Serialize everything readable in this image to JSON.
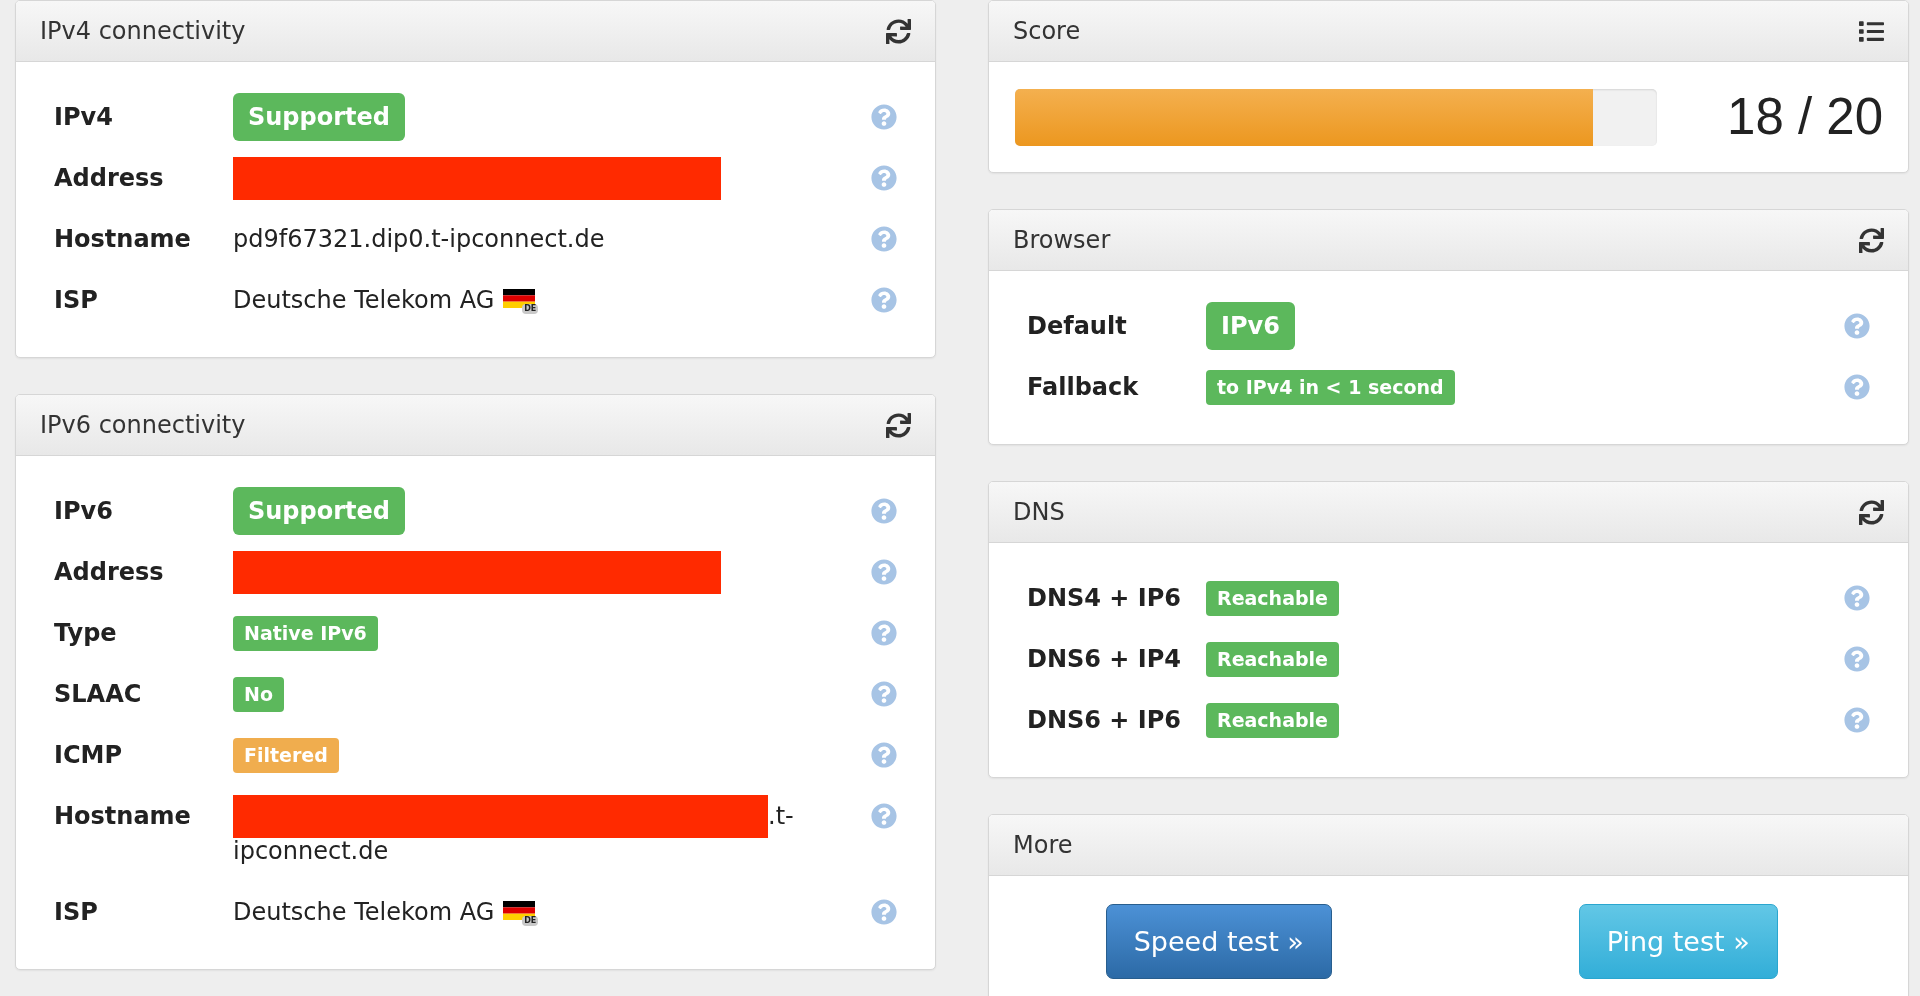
{
  "left_column": {
    "panels": [
      {
        "kind": "checks",
        "title": "IPv4 connectivity",
        "rows": [
          {
            "label": "IPv4",
            "kind": "result",
            "value": "Supported",
            "color": "#5cb85c"
          },
          {
            "label": "Address",
            "kind": "redacted"
          },
          {
            "label": "Hostname",
            "kind": "text",
            "value": "pd9f67321.dip0.t-ipconnect.de"
          },
          {
            "label": "ISP",
            "kind": "isp",
            "value": "Deutsche Telekom AG",
            "flag_code": "DE"
          }
        ]
      },
      {
        "kind": "checks",
        "title": "IPv6 connectivity",
        "rows": [
          {
            "label": "IPv6",
            "kind": "result",
            "value": "Supported",
            "color": "#5cb85c"
          },
          {
            "label": "Address",
            "kind": "redacted"
          },
          {
            "label": "Type",
            "kind": "badge",
            "value": "Native IPv6",
            "color": "#5cb85c"
          },
          {
            "label": "SLAAC",
            "kind": "badge",
            "value": "No",
            "color": "#5cb85c"
          },
          {
            "label": "ICMP",
            "kind": "badge",
            "value": "Filtered",
            "color": "#f0ad4e"
          },
          {
            "label": "Hostname",
            "kind": "redacted",
            "suffix_lines": [
              ".t-",
              "ipconnect.de"
            ]
          },
          {
            "label": "ISP",
            "kind": "isp",
            "value": "Deutsche Telekom AG",
            "flag_code": "DE"
          }
        ]
      }
    ]
  },
  "right_column": {
    "panels": [
      {
        "kind": "score",
        "title": "Score",
        "level": 0.9,
        "reading": "18 / 20"
      },
      {
        "kind": "checks",
        "title": "Browser",
        "rows": [
          {
            "label": "Default",
            "kind": "result",
            "value": "IPv6",
            "color": "#5cb85c"
          },
          {
            "label": "Fallback",
            "kind": "badge",
            "value": "to IPv4 in < 1 second",
            "color": "#5cb85c"
          }
        ]
      },
      {
        "kind": "checks",
        "title": "DNS",
        "rows": [
          {
            "label": "DNS4 + IP6",
            "kind": "badge",
            "value": "Reachable",
            "color": "#5cb85c"
          },
          {
            "label": "DNS6 + IP4",
            "kind": "badge",
            "value": "Reachable",
            "color": "#5cb85c"
          },
          {
            "label": "DNS6 + IP6",
            "kind": "badge",
            "value": "Reachable",
            "color": "#5cb85c"
          }
        ]
      },
      {
        "kind": "actions",
        "title": "More",
        "buttons": [
          {
            "label": "Speed test »",
            "kind": "primary"
          },
          {
            "label": "Ping test »",
            "kind": "info"
          }
        ]
      }
    ]
  }
}
